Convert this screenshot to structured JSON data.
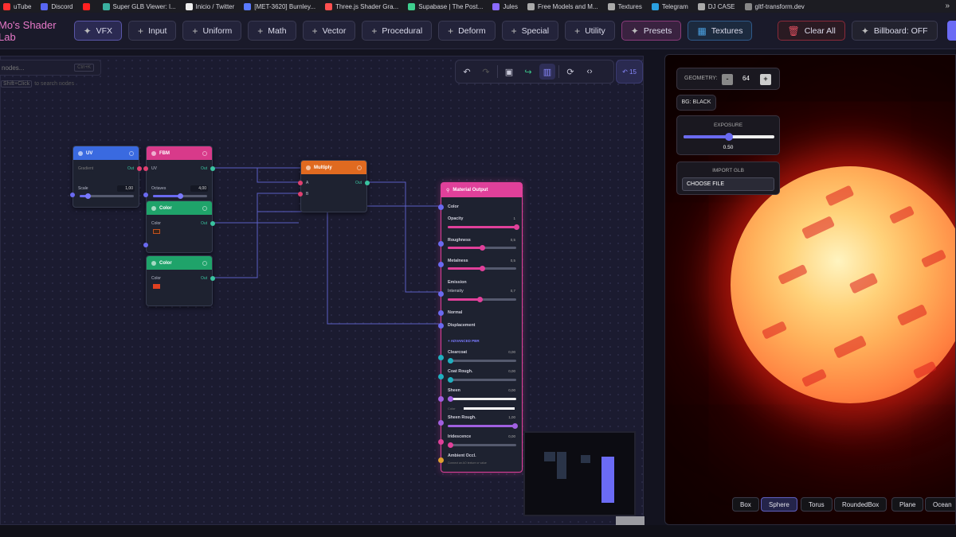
{
  "bookmarks": [
    {
      "label": "uTube",
      "color": "#ff3030"
    },
    {
      "label": "Discord",
      "color": "#5865f2"
    },
    {
      "label": "",
      "color": "#ff2020"
    },
    {
      "label": "Super GLB Viewer: l...",
      "color": "#3ab0a0"
    },
    {
      "label": "Inicio / Twitter",
      "color": "#eeeeee"
    },
    {
      "label": "[MET-3620] Burnley...",
      "color": "#5a7aff"
    },
    {
      "label": "Three.js Shader Gra...",
      "color": "#ff5050"
    },
    {
      "label": "Supabase | The Post...",
      "color": "#3ecf8e"
    },
    {
      "label": "Jules",
      "color": "#8a6aff"
    },
    {
      "label": "Free Models and M...",
      "color": "#aaaaaa"
    },
    {
      "label": "Textures",
      "color": "#aaaaaa"
    },
    {
      "label": "Telegram",
      "color": "#2aa0e0"
    },
    {
      "label": "DJ CASE",
      "color": "#aaaaaa"
    },
    {
      "label": "gltf-transform.dev",
      "color": "#888888"
    }
  ],
  "bookmarks_more": "»",
  "app": {
    "title": "Mo's Shader Lab"
  },
  "toolbar": {
    "vfx": "VFX",
    "input": "Input",
    "uniform": "Uniform",
    "math": "Math",
    "vector": "Vector",
    "procedural": "Procedural",
    "deform": "Deform",
    "special": "Special",
    "utility": "Utility",
    "presets": "Presets",
    "textures": "Textures",
    "clear_all": "Clear All",
    "billboard": "Billboard: OFF"
  },
  "search": {
    "placeholder": "nodes...",
    "shortcut": "Ctrl+K",
    "hint_key": "Shift+Click",
    "hint_text": "to search nodes"
  },
  "undo_count": "15",
  "nodes": {
    "uv": {
      "title": "UV",
      "out": "Out",
      "row1": "Gradient",
      "scale_label": "Scale",
      "scale_value": "1,00",
      "scale_fraction": 0.14
    },
    "fbm": {
      "title": "FBM",
      "out": "Out",
      "row1": "UV",
      "octaves_label": "Octaves",
      "octaves_value": "4,00",
      "octaves_fraction": 0.5
    },
    "color1": {
      "title": "Color",
      "out": "Out",
      "label": "Color",
      "swatch": "#3a2418"
    },
    "color2": {
      "title": "Color",
      "out": "Out",
      "label": "Color",
      "swatch": "#e04020"
    },
    "multiply": {
      "title": "Multiply",
      "out": "Out",
      "a": "A",
      "b": "B"
    }
  },
  "material_output": {
    "title": "Material Output",
    "color": "Color",
    "opacity_label": "Opacity",
    "opacity_value": "1",
    "opacity_fraction": 1.0,
    "roughness_label": "Roughness",
    "roughness_value": "0,5",
    "roughness_fraction": 0.5,
    "metalness_label": "Metalness",
    "metalness_value": "0,5",
    "metalness_fraction": 0.5,
    "emission": "Emission",
    "intensity_label": "Intensity",
    "intensity_value": "0,7",
    "intensity_fraction": 0.47,
    "normal": "Normal",
    "displacement": "Displacement",
    "advanced": "ADVANCED PBR",
    "clearcoat_label": "Clearcoat",
    "clearcoat_value": "0,00",
    "coat_rough_label": "Coat Rough.",
    "coat_rough_value": "0,00",
    "sheen_label": "Sheen",
    "sheen_value": "0,00",
    "sheen_color_label": "Color",
    "sheen_rough_label": "Sheen Rough.",
    "sheen_rough_value": "1,00",
    "iridescence_label": "Iridescence",
    "iridescence_value": "0,00",
    "ao_label": "Ambient Occl.",
    "ao_hint": "Connect an AO texture or value"
  },
  "preview": {
    "geometry_label": "GEOMETRY:",
    "geometry_value": "64",
    "minus": "-",
    "plus": "+",
    "bg": "BG: BLACK",
    "exposure_label": "EXPOSURE",
    "exposure_value": "0.50",
    "exposure_fraction": 0.5,
    "import_label": "IMPORT GLB",
    "choose_file": "CHOOSE FILE",
    "shapes": [
      "Box",
      "Sphere",
      "Torus",
      "RoundedBox",
      "Plane",
      "Ocean"
    ],
    "selected_shape": "Sphere"
  }
}
